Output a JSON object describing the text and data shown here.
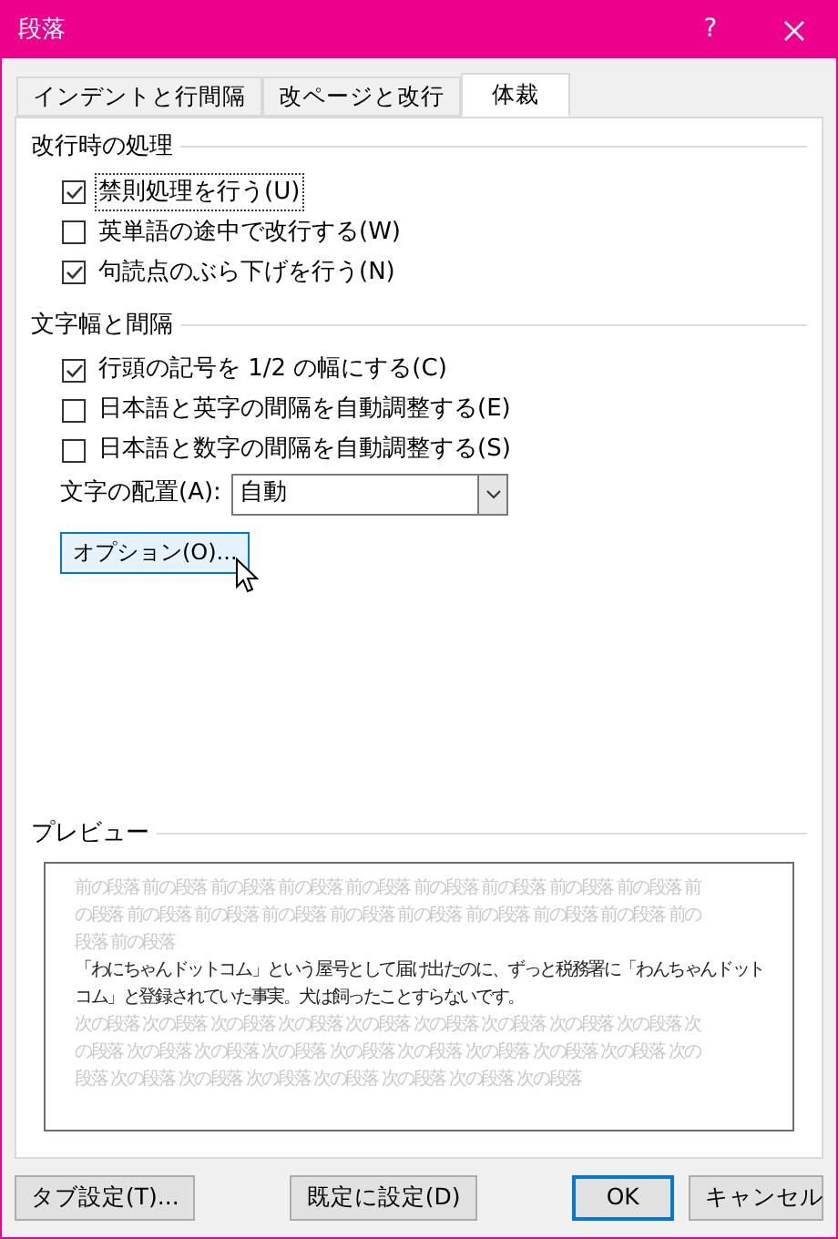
{
  "window": {
    "title": "段落",
    "help": "?"
  },
  "tabs": [
    {
      "label": "インデントと行間隔",
      "selected": false
    },
    {
      "label": "改ページと改行",
      "selected": false
    },
    {
      "label": "体裁",
      "selected": true
    }
  ],
  "sections": [
    {
      "title": "改行時の処理",
      "options": [
        {
          "label": "禁則処理を行う(U)",
          "checked": true,
          "focused": true
        },
        {
          "label": "英単語の途中で改行する(W)",
          "checked": false,
          "focused": false
        },
        {
          "label": "句読点のぶら下げを行う(N)",
          "checked": true,
          "focused": false
        }
      ]
    },
    {
      "title": "文字幅と間隔",
      "options": [
        {
          "label": "行頭の記号を 1/2 の幅にする(C)",
          "checked": true,
          "focused": false
        },
        {
          "label": "日本語と英字の間隔を自動調整する(E)",
          "checked": false,
          "focused": false
        },
        {
          "label": "日本語と数字の間隔を自動調整する(S)",
          "checked": false,
          "focused": false
        }
      ]
    }
  ],
  "alignment": {
    "label": "文字の配置(A):",
    "value": "自動"
  },
  "options_button": "オプション(O)...",
  "preview": {
    "title": "プレビュー",
    "paragraphs": [
      {
        "kind": "other",
        "lines": [
          "前の段落 前の段落 前の段落 前の段落 前の段落 前の段落 前の段落 前の段落 前の段落 前",
          "の段落 前の段落 前の段落 前の段落 前の段落 前の段落 前の段落 前の段落 前の段落 前の",
          "段落 前の段落"
        ]
      },
      {
        "kind": "sample",
        "lines": [
          "「わにちゃんドットコム」という屋号として届け出たのに、ずっと税務署に「わんちゃんドット",
          "コム」と登録されていた事実。犬は飼ったことすらないです。"
        ]
      },
      {
        "kind": "other",
        "lines": [
          "次の段落 次の段落 次の段落 次の段落 次の段落 次の段落 次の段落 次の段落 次の段落 次",
          "の段落 次の段落 次の段落 次の段落 次の段落 次の段落 次の段落 次の段落 次の段落 次の",
          "段落 次の段落 次の段落 次の段落 次の段落 次の段落 次の段落 次の段落"
        ]
      }
    ]
  },
  "buttons": [
    {
      "label": "タブ設定(T)...",
      "default": false
    },
    {
      "label": "既定に設定(D)",
      "default": false
    },
    {
      "label": "OK",
      "default": true
    },
    {
      "label": "キャンセル",
      "default": false
    }
  ]
}
